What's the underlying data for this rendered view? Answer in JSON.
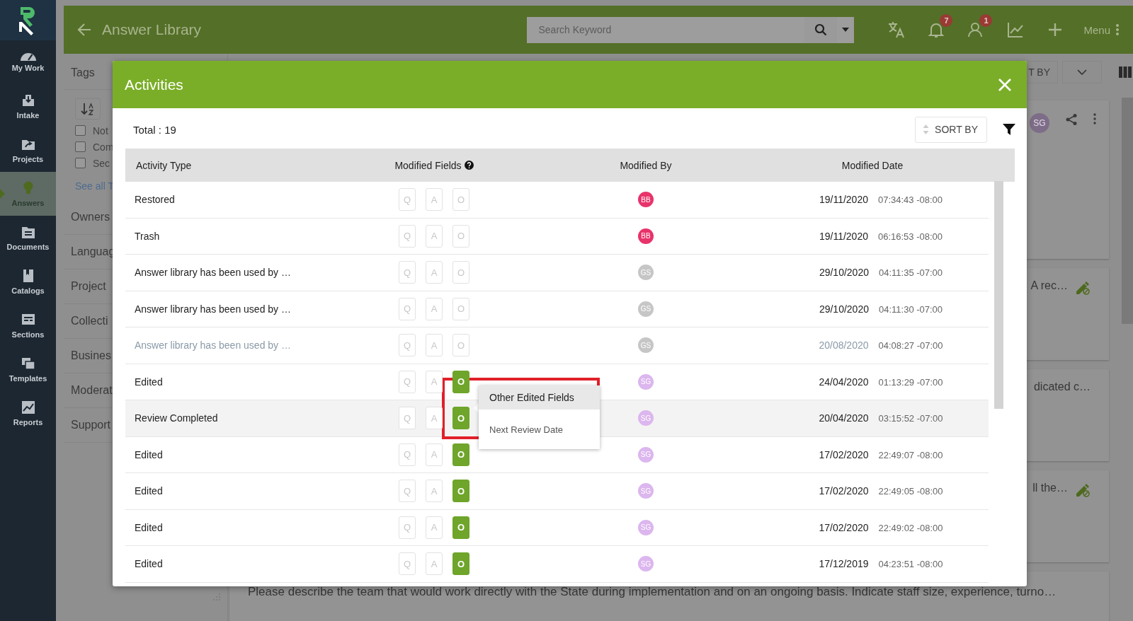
{
  "sidebar": {
    "items": [
      {
        "label": "My Work",
        "selected": false
      },
      {
        "label": "Intake",
        "selected": false
      },
      {
        "label": "Projects",
        "selected": false
      },
      {
        "label": "Answers",
        "selected": true
      },
      {
        "label": "Documents",
        "selected": false
      },
      {
        "label": "Catalogs",
        "selected": false
      },
      {
        "label": "Sections",
        "selected": false
      },
      {
        "label": "Templates",
        "selected": false
      },
      {
        "label": "Reports",
        "selected": false
      }
    ]
  },
  "top_bar": {
    "title": "Answer Library",
    "search": {
      "placeholder": "Search Keyword"
    },
    "notifications_badge": "7",
    "users_badge": "1",
    "menu_label": "Menu"
  },
  "filter_panel": {
    "title": "Tags",
    "tags": [
      {
        "label": "Not",
        "checked": false
      },
      {
        "label": "Com",
        "checked": false
      },
      {
        "label": "Sec",
        "checked": false
      }
    ],
    "see_all_link": "See all T",
    "sections": [
      "Owners",
      "Languag",
      "Project",
      "Collecti",
      "Busines",
      "Moderat",
      "Support"
    ]
  },
  "results": {
    "sort_button": "T BY",
    "cards": [
      {
        "kind": "header",
        "avatar": "SG"
      },
      {
        "kind": "text",
        "text": "A rec…",
        "editable": true
      },
      {
        "kind": "text",
        "text": "dicated c…",
        "editable": false
      },
      {
        "kind": "text",
        "text": "ll the…",
        "editable": true
      },
      {
        "kind": "full",
        "text": "Please describe the team that would work directly with the State during implementation and on an ongoing basis. Indicate staff size, experience, turno…"
      }
    ]
  },
  "activities_dialog": {
    "title": "Activities",
    "total": "Total : 19",
    "sort_button": "SORT BY",
    "columns": [
      "Activity Type",
      "Modified Fields",
      "Modified By",
      "Modified Date"
    ],
    "rows": [
      {
        "activity": "Restored",
        "muted": false,
        "selected": false,
        "fields": [
          {
            "label": "Q",
            "active": false
          },
          {
            "label": "A",
            "active": false
          },
          {
            "label": "O",
            "active": false
          }
        ],
        "modified_by": {
          "initials": "BB",
          "color": "#e8336b"
        },
        "date": "19/11/2020",
        "time": "07:34:43 -08:00"
      },
      {
        "activity": "Trash",
        "muted": false,
        "selected": false,
        "fields": [
          {
            "label": "Q",
            "active": false
          },
          {
            "label": "A",
            "active": false
          },
          {
            "label": "O",
            "active": false
          }
        ],
        "modified_by": {
          "initials": "BB",
          "color": "#e8336b"
        },
        "date": "19/11/2020",
        "time": "06:16:53 -08:00"
      },
      {
        "activity": "Answer library has been used by …",
        "muted": false,
        "selected": false,
        "fields": [
          {
            "label": "Q",
            "active": false
          },
          {
            "label": "A",
            "active": false
          },
          {
            "label": "O",
            "active": false
          }
        ],
        "modified_by": {
          "initials": "GS",
          "color": "#c6c6c6"
        },
        "date": "29/10/2020",
        "time": "04:11:35 -07:00"
      },
      {
        "activity": "Answer library has been used by …",
        "muted": false,
        "selected": false,
        "fields": [
          {
            "label": "Q",
            "active": false
          },
          {
            "label": "A",
            "active": false
          },
          {
            "label": "O",
            "active": false
          }
        ],
        "modified_by": {
          "initials": "GS",
          "color": "#c6c6c6"
        },
        "date": "29/10/2020",
        "time": "04:11:30 -07:00"
      },
      {
        "activity": "Answer library has been used by …",
        "muted": true,
        "selected": false,
        "fields": [
          {
            "label": "Q",
            "active": false
          },
          {
            "label": "A",
            "active": false
          },
          {
            "label": "O",
            "active": false
          }
        ],
        "modified_by": {
          "initials": "GS",
          "color": "#c6c6c6"
        },
        "date": "20/08/2020",
        "time": "04:08:27 -07:00"
      },
      {
        "activity": "Edited",
        "muted": false,
        "selected": false,
        "fields": [
          {
            "label": "Q",
            "active": false
          },
          {
            "label": "A",
            "active": false
          },
          {
            "label": "O",
            "active": true
          }
        ],
        "modified_by": {
          "initials": "SG",
          "color": "#dcb6ee"
        },
        "date": "24/04/2020",
        "time": "01:13:29 -07:00"
      },
      {
        "activity": "Review Completed",
        "muted": false,
        "selected": true,
        "fields": [
          {
            "label": "Q",
            "active": false
          },
          {
            "label": "A",
            "active": false
          },
          {
            "label": "O",
            "active": true
          }
        ],
        "modified_by": {
          "initials": "SG",
          "color": "#dcb6ee"
        },
        "date": "20/04/2020",
        "time": "03:15:52 -07:00"
      },
      {
        "activity": "Edited",
        "muted": false,
        "selected": false,
        "fields": [
          {
            "label": "Q",
            "active": false
          },
          {
            "label": "A",
            "active": false
          },
          {
            "label": "O",
            "active": true
          }
        ],
        "modified_by": {
          "initials": "SG",
          "color": "#dcb6ee"
        },
        "date": "17/02/2020",
        "time": "22:49:07 -08:00"
      },
      {
        "activity": "Edited",
        "muted": false,
        "selected": false,
        "fields": [
          {
            "label": "Q",
            "active": false
          },
          {
            "label": "A",
            "active": false
          },
          {
            "label": "O",
            "active": true
          }
        ],
        "modified_by": {
          "initials": "SG",
          "color": "#dcb6ee"
        },
        "date": "17/02/2020",
        "time": "22:49:05 -08:00"
      },
      {
        "activity": "Edited",
        "muted": false,
        "selected": false,
        "fields": [
          {
            "label": "Q",
            "active": false
          },
          {
            "label": "A",
            "active": false
          },
          {
            "label": "O",
            "active": true
          }
        ],
        "modified_by": {
          "initials": "SG",
          "color": "#dcb6ee"
        },
        "date": "17/02/2020",
        "time": "22:49:02 -08:00"
      },
      {
        "activity": "Edited",
        "muted": false,
        "selected": false,
        "fields": [
          {
            "label": "Q",
            "active": false
          },
          {
            "label": "A",
            "active": false
          },
          {
            "label": "O",
            "active": true
          }
        ],
        "modified_by": {
          "initials": "SG",
          "color": "#dcb6ee"
        },
        "date": "17/12/2019",
        "time": "04:23:51 -08:00"
      }
    ],
    "popover": {
      "title": "Other Edited Fields",
      "items": [
        "Next Review Date"
      ]
    }
  }
}
